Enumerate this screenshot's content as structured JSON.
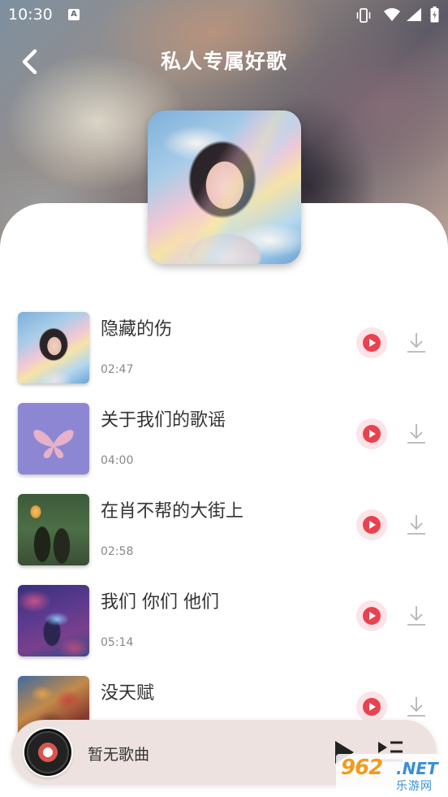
{
  "status_bar": {
    "time": "10:30",
    "a_badge": "A"
  },
  "header": {
    "title": "私人专属好歌",
    "back_icon": "chevron-left-icon"
  },
  "songs": [
    {
      "title": "隐藏的伤",
      "duration": "02:47"
    },
    {
      "title": "关于我们的歌谣",
      "duration": "04:00"
    },
    {
      "title": "在肖不帮的大街上",
      "duration": "02:58"
    },
    {
      "title": "我们 你们 他们",
      "duration": "05:14"
    },
    {
      "title": "没天赋",
      "duration": ""
    }
  ],
  "player": {
    "now_playing": "暂无歌曲"
  },
  "watermark": {
    "brand_number": "962",
    "brand_suffix": ".NET",
    "site_name": "乐游网"
  },
  "colors": {
    "accent": "#e8424f",
    "play_bg": "#fbe3e7",
    "player_bar_bg": "#ede2df"
  }
}
